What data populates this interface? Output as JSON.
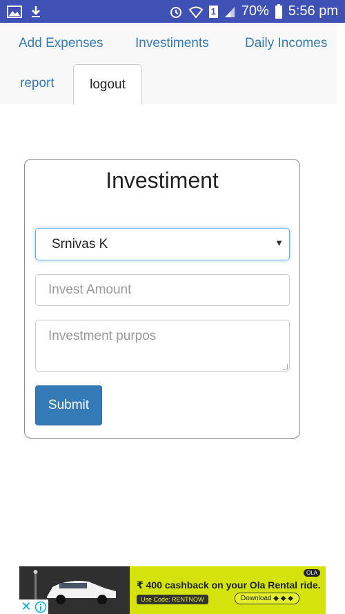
{
  "status_bar": {
    "battery": "70%",
    "time": "5:56 pm",
    "sim_slot": "1",
    "icons": [
      "gallery-icon",
      "download-icon",
      "alarm-icon",
      "wifi-icon",
      "signal-icon",
      "battery-icon"
    ]
  },
  "nav": {
    "add_expenses": "Add Expenses",
    "investments": "Investiments",
    "daily_incomes": "Daily Incomes",
    "report": "report",
    "logout": "logout"
  },
  "form": {
    "title": "Investiment",
    "selected_person": "Srnivas K",
    "amount_placeholder": "Invest Amount",
    "purpose_placeholder": "Investment purpos",
    "submit_label": "Submit"
  },
  "ad": {
    "headline": "₹ 400 cashback on your Ola Rental ride.",
    "code": "Use Code: RENTNOW",
    "download": "Download",
    "brand": "OLA"
  },
  "colors": {
    "status_bar": "#3f51b5",
    "link": "#337ab7",
    "primary_button": "#337ab7",
    "ad_yellow": "#d4e30c"
  }
}
